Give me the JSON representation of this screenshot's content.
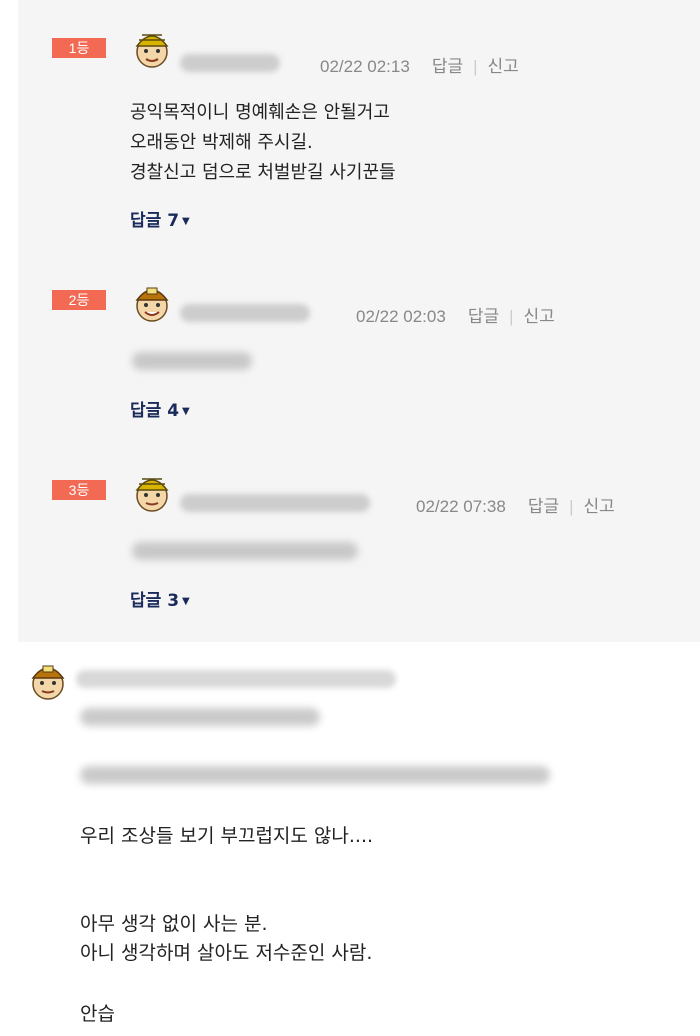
{
  "best_comments": [
    {
      "rank": "1등",
      "date": "02/22 02:13",
      "reply_label": "답글",
      "report_label": "신고",
      "text": "공익목적이니 명예훼손은 안될거고\n오래동안 박제해 주시길.\n경찰신고 덤으로 처벌받길 사기꾼들",
      "replies_label": "답글",
      "replies_count": "7",
      "avatar_hat": "#d8b300"
    },
    {
      "rank": "2등",
      "date": "02/22 02:03",
      "reply_label": "답글",
      "report_label": "신고",
      "replies_label": "답글",
      "replies_count": "4",
      "avatar_hat": "#b8740a"
    },
    {
      "rank": "3등",
      "date": "02/22 07:38",
      "reply_label": "답글",
      "report_label": "신고",
      "replies_label": "답글",
      "replies_count": "3",
      "avatar_hat": "#d8b300"
    }
  ],
  "main_comment": {
    "avatar_hat": "#b8740a",
    "line1": "우리 조상들 보기 부끄럽지도 않나....",
    "line2": "아무 생각 없이 사는 분.\n아니 생각하며 살아도 저수준인 사람.",
    "line3": "안습"
  },
  "colors": {
    "badge": "#f36a54",
    "panel": "#f5f5f5",
    "reply_link": "#1a2a5a"
  }
}
